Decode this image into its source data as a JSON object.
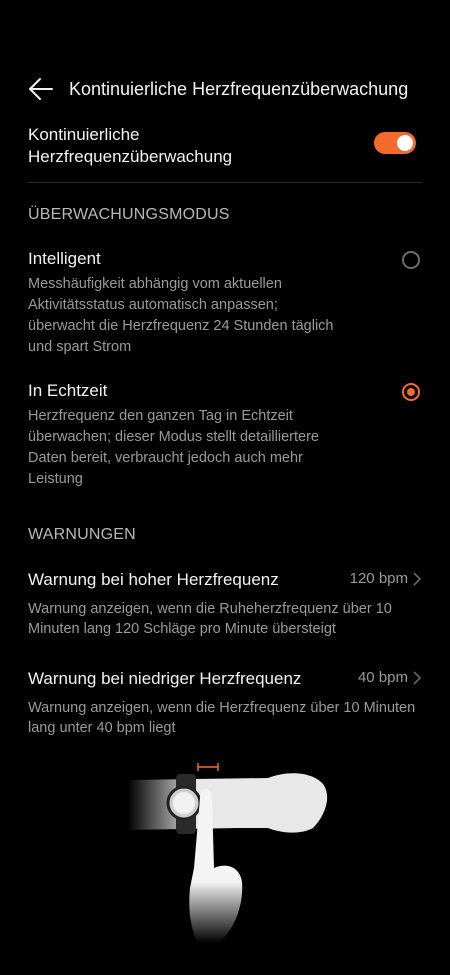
{
  "header": {
    "title": "Kontinuierliche Herzfrequenzüberwachung"
  },
  "toggle": {
    "label": "Kontinuierliche Herzfrequenzüberwachung",
    "state": "on",
    "accent": "#f46a2c"
  },
  "mode_section": {
    "title": "ÜBERWACHUNGSMODUS"
  },
  "options": [
    {
      "title": "Intelligent",
      "description": "Messhäufigkeit abhängig vom aktuellen Aktivitätsstatus automatisch anpassen; überwacht die Herzfrequenz 24 Stunden täglich und spart Strom",
      "selected": false
    },
    {
      "title": "In Echtzeit",
      "description": "Herzfrequenz den ganzen Tag in Echtzeit überwachen; dieser Modus stellt detailliertere Daten bereit, verbraucht jedoch auch mehr Leistung",
      "selected": true
    }
  ],
  "warnings_section": {
    "title": "WARNUNGEN"
  },
  "warnings": [
    {
      "title": "Warnung bei hoher Herzfrequenz",
      "value": "120 bpm",
      "description": "Warnung anzeigen, wenn die Ruheherzfrequenz über 10 Minuten lang 120 Schläge pro Minute übersteigt"
    },
    {
      "title": "Warnung bei niedriger Herzfrequenz",
      "value": "40 bpm",
      "description": "Warnung anzeigen, wenn die Herzfrequenz über 10 Minuten lang unter 40 bpm liegt"
    }
  ],
  "icons": {
    "back": "arrow-left-icon",
    "chevron": "chevron-right-icon"
  }
}
